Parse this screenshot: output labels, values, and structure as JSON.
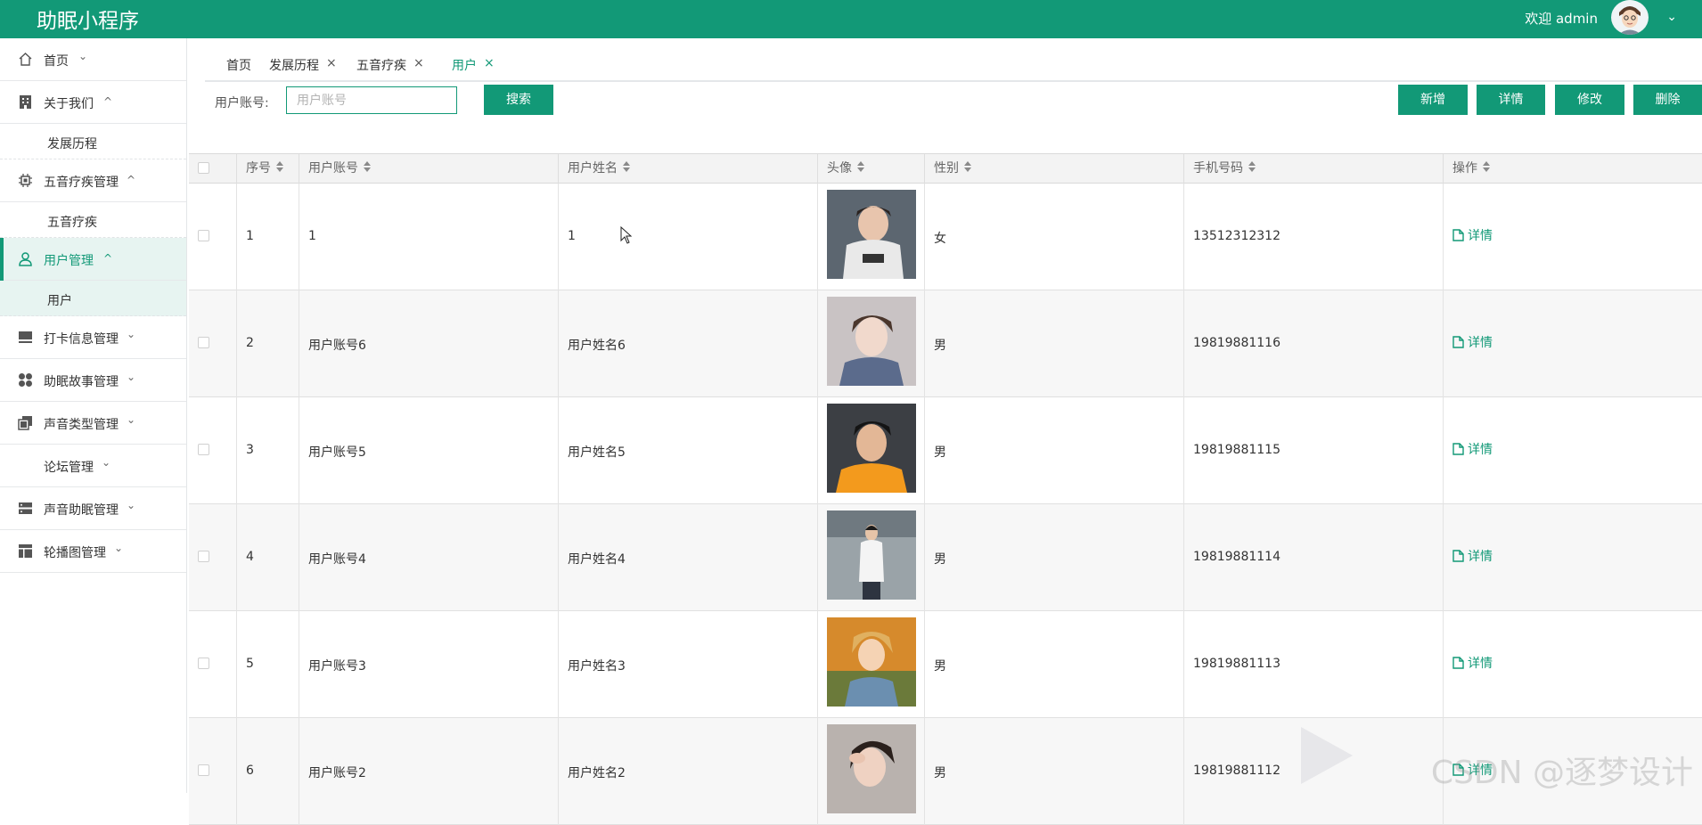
{
  "header": {
    "app_title": "助眠小程序",
    "welcome": "欢迎 admin",
    "caret": "⌄",
    "brand_color": "#129977"
  },
  "sidebar": {
    "items": [
      {
        "label": "首页",
        "icon": "home-icon",
        "caret": "⌄"
      },
      {
        "label": "关于我们",
        "icon": "building-icon",
        "caret": "^"
      },
      {
        "label": "发展历程",
        "sub": true
      },
      {
        "label": "五音疗疾管理",
        "icon": "chip-icon",
        "caret": "^"
      },
      {
        "label": "五音疗疾",
        "sub": true
      },
      {
        "label": "用户管理",
        "icon": "user-icon",
        "caret": "^",
        "active": true
      },
      {
        "label": "用户",
        "sub": true,
        "active": true
      },
      {
        "label": "打卡信息管理",
        "icon": "card-icon",
        "caret": "⌄"
      },
      {
        "label": "助眠故事管理",
        "icon": "grid-dots-icon",
        "caret": "⌄"
      },
      {
        "label": "声音类型管理",
        "icon": "copy-icon",
        "caret": "⌄"
      },
      {
        "label": "论坛管理",
        "icon": "",
        "caret": "⌄"
      },
      {
        "label": "声音助眠管理",
        "icon": "server-icon",
        "caret": "⌄"
      },
      {
        "label": "轮播图管理",
        "icon": "layout-icon",
        "caret": "⌄"
      }
    ]
  },
  "tabs": [
    {
      "label": "首页",
      "closable": false
    },
    {
      "label": "发展历程",
      "closable": true
    },
    {
      "label": "五音疗疾",
      "closable": true
    },
    {
      "label": "用户",
      "closable": true,
      "active": true
    }
  ],
  "tab_close": "×",
  "toolbar": {
    "search_label": "用户账号:",
    "search_placeholder": "用户账号",
    "search_button": "搜索",
    "add_button": "新增",
    "detail_button": "详情",
    "edit_button": "修改",
    "delete_button": "删除"
  },
  "table": {
    "columns": [
      "序号",
      "用户账号",
      "用户姓名",
      "头像",
      "性别",
      "手机号码",
      "操作"
    ],
    "rows": [
      {
        "no": "1",
        "account": "1",
        "name": "1",
        "gender": "女",
        "phone": "13512312312",
        "action": "详情"
      },
      {
        "no": "2",
        "account": "用户账号6",
        "name": "用户姓名6",
        "gender": "男",
        "phone": "19819881116",
        "action": "详情"
      },
      {
        "no": "3",
        "account": "用户账号5",
        "name": "用户姓名5",
        "gender": "男",
        "phone": "19819881115",
        "action": "详情"
      },
      {
        "no": "4",
        "account": "用户账号4",
        "name": "用户姓名4",
        "gender": "男",
        "phone": "19819881114",
        "action": "详情"
      },
      {
        "no": "5",
        "account": "用户账号3",
        "name": "用户姓名3",
        "gender": "男",
        "phone": "19819881113",
        "action": "详情"
      },
      {
        "no": "6",
        "account": "用户账号2",
        "name": "用户姓名2",
        "gender": "男",
        "phone": "19819881112",
        "action": "详情"
      }
    ]
  },
  "watermark": "CSDN @逐梦设计"
}
